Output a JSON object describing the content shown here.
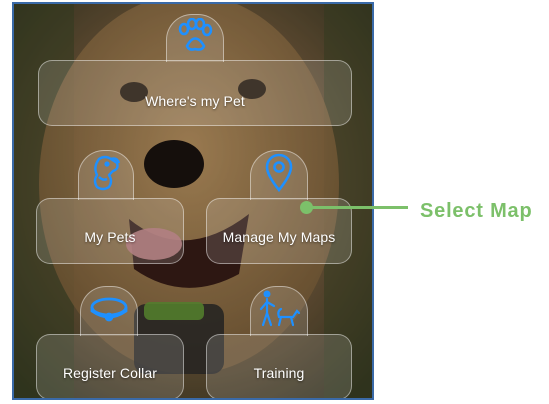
{
  "menu": {
    "wheres_my_pet": {
      "label": "Where's my Pet",
      "icon": "paw-icon"
    },
    "my_pets": {
      "label": "My Pets",
      "icon": "dog-icon"
    },
    "manage_maps": {
      "label": "Manage My Maps",
      "icon": "map-pin-icon"
    },
    "register_collar": {
      "label": "Register Collar",
      "icon": "collar-icon"
    },
    "training": {
      "label": "Training",
      "icon": "trainer-dog-icon"
    }
  },
  "callout": {
    "text": "Select Map"
  },
  "colors": {
    "icon_blue": "#1e90ff",
    "callout_green": "#7cc06a",
    "frame_blue": "#3a6aa8"
  }
}
